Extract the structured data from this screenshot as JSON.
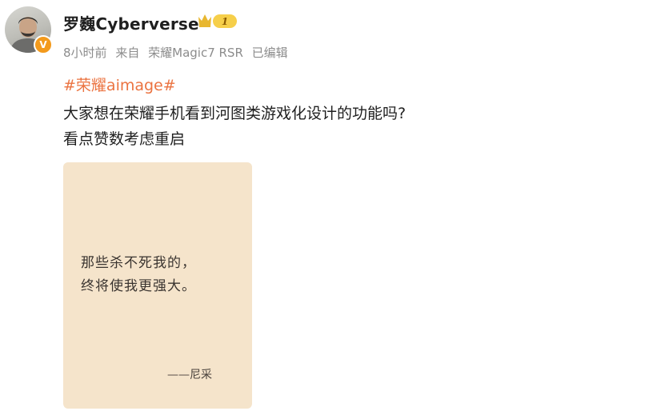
{
  "post": {
    "author": {
      "name": "罗巍Cyberverse",
      "vip_level": "1"
    },
    "meta": {
      "time": "8小时前",
      "source_prefix": "来自",
      "device": "荣耀Magic7 RSR",
      "edited": "已编辑"
    },
    "hashtag": "#荣耀aimage#",
    "lines": [
      "大家想在荣耀手机看到河图类游戏化设计的功能吗?",
      "看点赞数考虑重启"
    ],
    "image": {
      "quote_lines": [
        "那些杀不死我的，",
        "终将使我更强大。"
      ],
      "attribution": "——尼采"
    }
  },
  "colors": {
    "hashtag": "#eb7340",
    "meta": "#8c8c8c",
    "card_bg": "#f5e4cb",
    "verify_badge": "#f39a1c"
  },
  "icons": {
    "verify": "verified-v-icon",
    "vip": "crown-vip-badge-icon"
  }
}
